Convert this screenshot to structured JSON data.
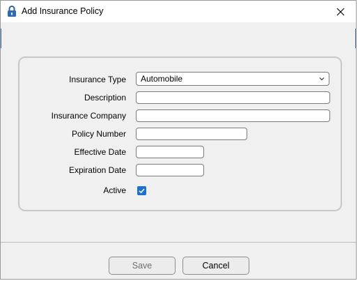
{
  "window": {
    "title": "Add Insurance Policy",
    "icon": "padlock-icon",
    "close_icon": "close-icon"
  },
  "form": {
    "insurance_type": {
      "label": "Insurance Type",
      "value": "Automobile"
    },
    "description": {
      "label": "Description",
      "value": ""
    },
    "insurance_company": {
      "label": "Insurance Company",
      "value": ""
    },
    "policy_number": {
      "label": "Policy Number",
      "value": ""
    },
    "effective_date": {
      "label": "Effective Date",
      "value": ""
    },
    "expiration_date": {
      "label": "Expiration Date",
      "value": ""
    },
    "active": {
      "label": "Active",
      "checked": true
    }
  },
  "buttons": {
    "save": {
      "label": "Save",
      "enabled": false
    },
    "cancel": {
      "label": "Cancel",
      "enabled": true
    }
  },
  "colors": {
    "accent": "#1f6fcf",
    "window_background": "#f0f0f0"
  }
}
